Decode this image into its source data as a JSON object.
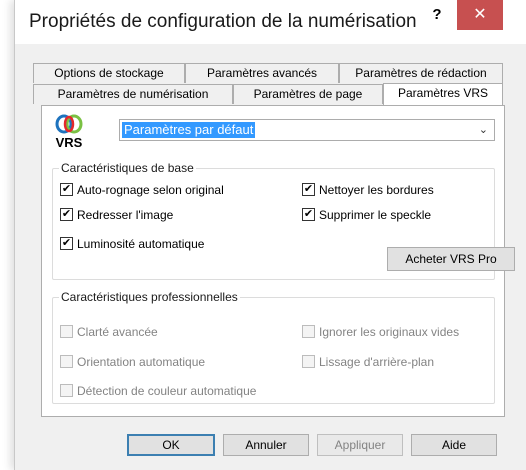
{
  "window": {
    "title": "Propriétés de configuration de la numérisation",
    "help": "?",
    "close": "✕"
  },
  "tabs": {
    "row1": [
      "Options de stockage",
      "Paramètres avancés",
      "Paramètres de rédaction"
    ],
    "row2": [
      "Paramètres de numérisation",
      "Paramètres de page",
      "Paramètres VRS"
    ],
    "active": "Paramètres VRS"
  },
  "vrs": {
    "logo_text": "VRS",
    "profile_value": "Paramètres par défaut",
    "dropdown_icon": "chevron-down-icon"
  },
  "basic": {
    "title": "Caractéristiques de base",
    "items": [
      {
        "label": "Auto-rognage selon original",
        "checked": true
      },
      {
        "label": "Nettoyer les bordures",
        "checked": true
      },
      {
        "label": "Redresser l'image",
        "checked": true
      },
      {
        "label": "Supprimer le speckle",
        "checked": true
      },
      {
        "label": "Luminosité automatique",
        "checked": true
      }
    ],
    "buy_button": "Acheter VRS Pro"
  },
  "pro": {
    "title": "Caractéristiques professionnelles",
    "items": [
      {
        "label": "Clarté avancée",
        "checked": false
      },
      {
        "label": "Ignorer les originaux vides",
        "checked": false
      },
      {
        "label": "Orientation automatique",
        "checked": false
      },
      {
        "label": "Lissage d'arrière-plan",
        "checked": false
      },
      {
        "label": "Détection de couleur automatique",
        "checked": false
      }
    ]
  },
  "buttons": {
    "ok": "OK",
    "cancel": "Annuler",
    "apply": "Appliquer",
    "help": "Aide"
  },
  "colors": {
    "accent": "#3399ff",
    "close": "#c75050"
  },
  "check_glyph": "✔"
}
